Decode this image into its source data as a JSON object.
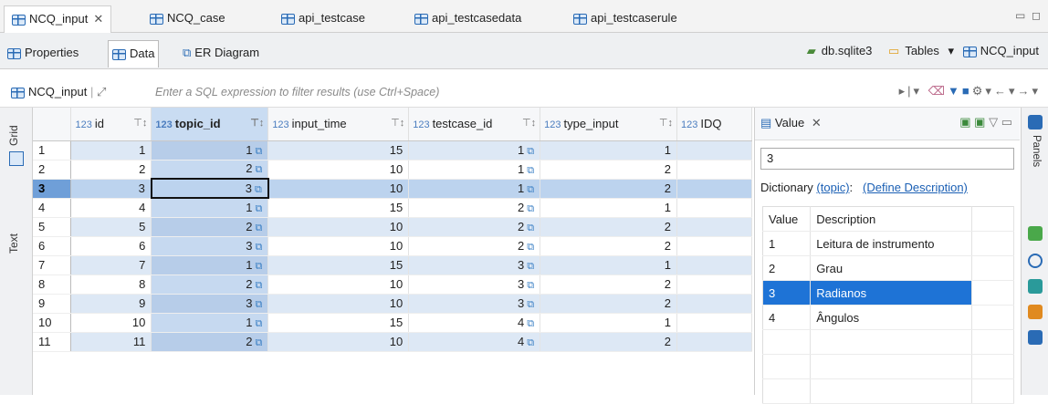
{
  "editor_tabs": [
    "NCQ_input",
    "NCQ_case",
    "api_testcase",
    "api_testcasedata",
    "api_testcaserule"
  ],
  "sub_tabs": [
    "Properties",
    "Data",
    "ER Diagram"
  ],
  "crumbs": {
    "db": "db.sqlite3",
    "folder": "Tables",
    "table": "NCQ_input"
  },
  "filter": {
    "table": "NCQ_input",
    "placeholder": "Enter a SQL expression to filter results (use Ctrl+Space)"
  },
  "side_tabs": [
    "Grid",
    "Text"
  ],
  "grid": {
    "columns": [
      "id",
      "topic_id",
      "input_time",
      "testcase_id",
      "type_input",
      "IDQ"
    ],
    "type_badge": "123",
    "rows": [
      {
        "n": "1",
        "id": "1",
        "topic_id": "1",
        "input_time": "15",
        "testcase_id": "1",
        "type_input": "1"
      },
      {
        "n": "2",
        "id": "2",
        "topic_id": "2",
        "input_time": "10",
        "testcase_id": "1",
        "type_input": "2"
      },
      {
        "n": "3",
        "id": "3",
        "topic_id": "3",
        "input_time": "10",
        "testcase_id": "1",
        "type_input": "2"
      },
      {
        "n": "4",
        "id": "4",
        "topic_id": "1",
        "input_time": "15",
        "testcase_id": "2",
        "type_input": "1"
      },
      {
        "n": "5",
        "id": "5",
        "topic_id": "2",
        "input_time": "10",
        "testcase_id": "2",
        "type_input": "2"
      },
      {
        "n": "6",
        "id": "6",
        "topic_id": "3",
        "input_time": "10",
        "testcase_id": "2",
        "type_input": "2"
      },
      {
        "n": "7",
        "id": "7",
        "topic_id": "1",
        "input_time": "15",
        "testcase_id": "3",
        "type_input": "1"
      },
      {
        "n": "8",
        "id": "8",
        "topic_id": "2",
        "input_time": "10",
        "testcase_id": "3",
        "type_input": "2"
      },
      {
        "n": "9",
        "id": "9",
        "topic_id": "3",
        "input_time": "10",
        "testcase_id": "3",
        "type_input": "2"
      },
      {
        "n": "10",
        "id": "10",
        "topic_id": "1",
        "input_time": "15",
        "testcase_id": "4",
        "type_input": "1"
      },
      {
        "n": "11",
        "id": "11",
        "topic_id": "2",
        "input_time": "10",
        "testcase_id": "4",
        "type_input": "2"
      }
    ]
  },
  "value_panel": {
    "title": "Value",
    "value": "3",
    "dict_label": "Dictionary",
    "dict_topic": "(topic)",
    "dict_colon": ":",
    "dict_define": "(Define Description)",
    "headers": [
      "Value",
      "Description"
    ],
    "items": [
      {
        "v": "1",
        "d": "Leitura de instrumento"
      },
      {
        "v": "2",
        "d": "Grau"
      },
      {
        "v": "3",
        "d": "Radianos"
      },
      {
        "v": "4",
        "d": "Ângulos"
      }
    ]
  },
  "panels_label": "Panels",
  "colors": {
    "selection": "#1e73d6",
    "alt_row": "#dde8f5",
    "link": "#3a7fc4"
  }
}
